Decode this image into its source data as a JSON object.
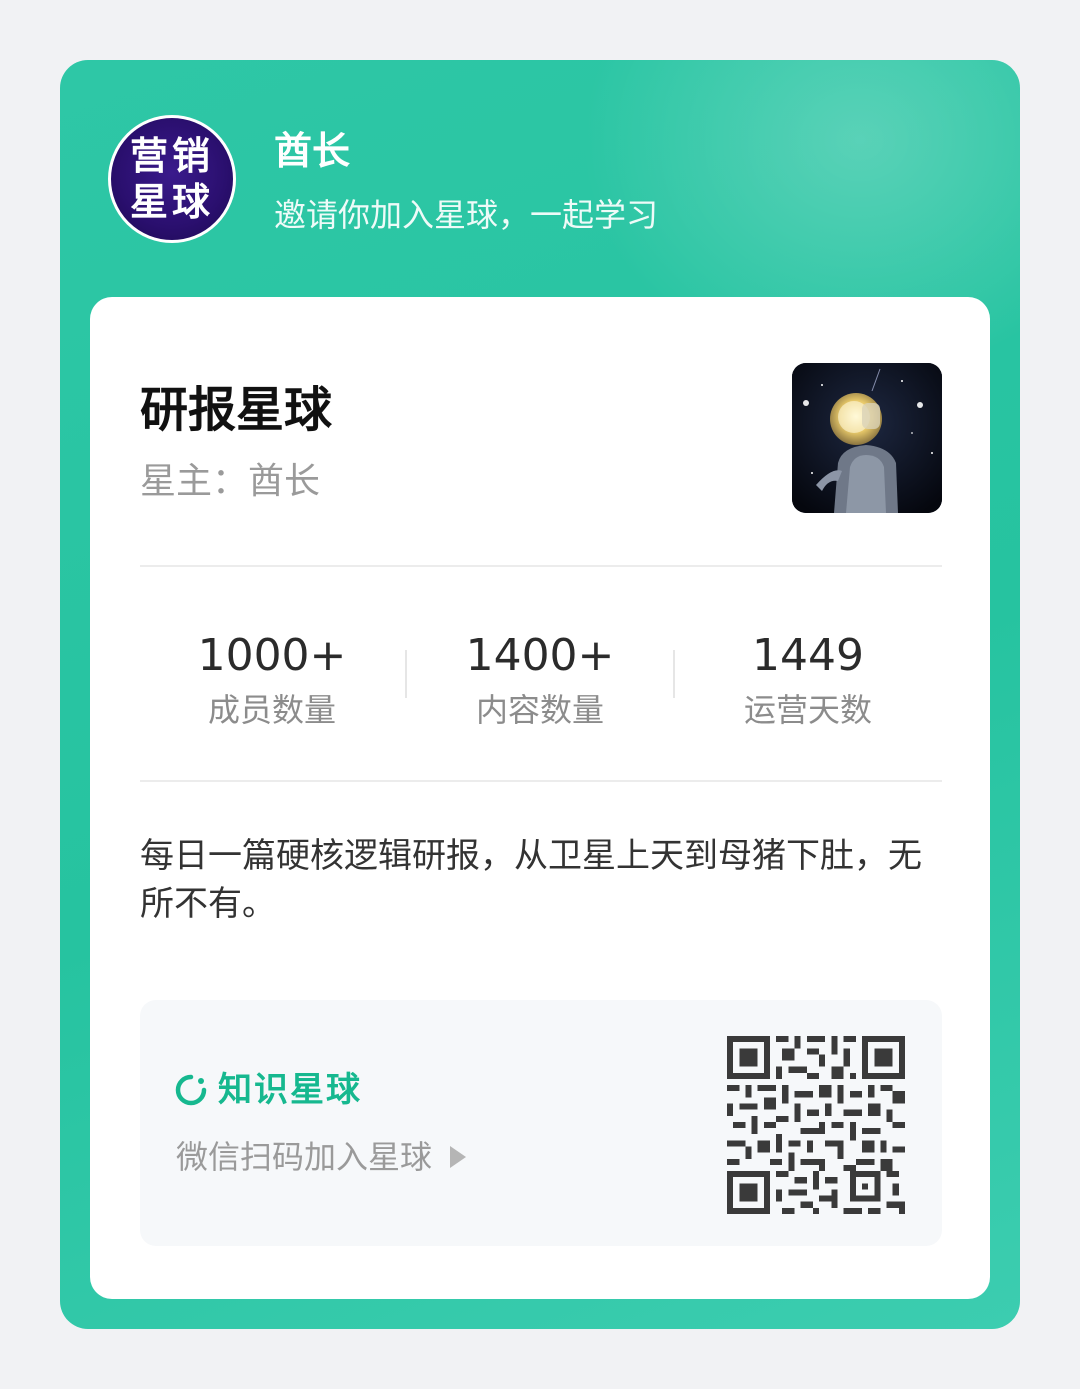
{
  "header": {
    "avatar_line1": "营销",
    "avatar_line2": "星球",
    "owner_name": "酋长",
    "invite_text": "邀请你加入星球，一起学习"
  },
  "planet": {
    "title": "研报星球",
    "owner_label": "星主：酋长",
    "cover_icon": "astronaut-cover-image"
  },
  "stats": [
    {
      "value": "1000+",
      "label": "成员数量"
    },
    {
      "value": "1400+",
      "label": "内容数量"
    },
    {
      "value": "1449",
      "label": "运营天数"
    }
  ],
  "description": "每日一篇硬核逻辑研报，从卫星上天到母猪下肚，无所不有。",
  "join": {
    "brand_name": "知识星球",
    "brand_icon": "zsxq-logo-icon",
    "scan_text": "微信扫码加入星球",
    "arrow_icon": "play-arrow-icon",
    "qr_icon": "qr-code"
  },
  "colors": {
    "outer_bg": "#2ec7a6",
    "brand_green": "#16b88f",
    "avatar_bg": "#2a0f6e",
    "page_bg": "#f1f2f4"
  }
}
